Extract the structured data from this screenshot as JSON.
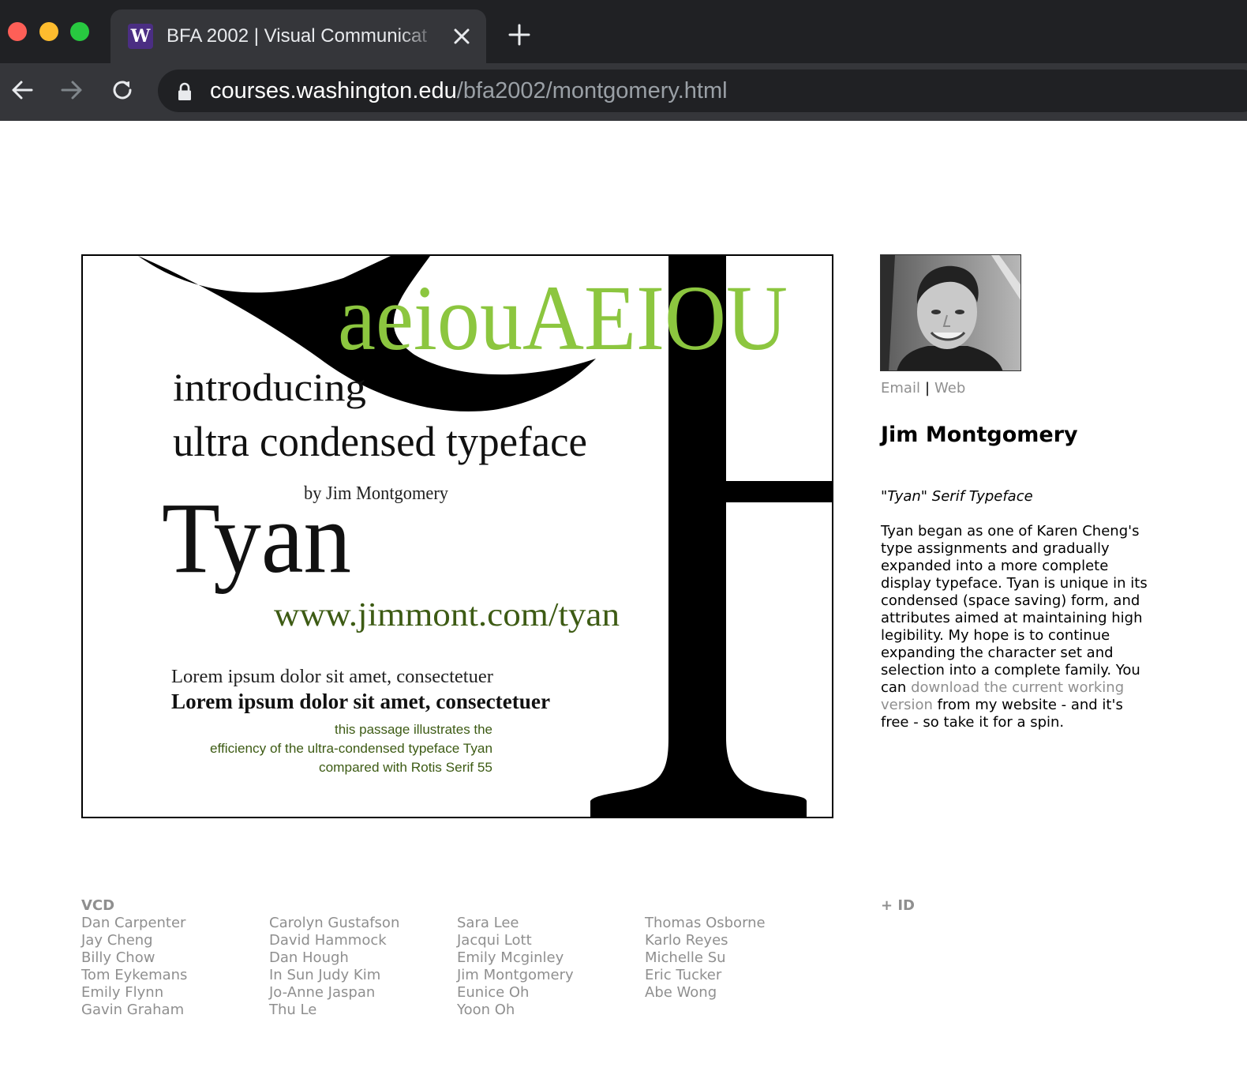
{
  "browser": {
    "tab_title": "BFA 2002 | Visual Communicat",
    "favicon_letter": "W",
    "url_host": "courses.washington.edu",
    "url_path": "/bfa2002/montgomery.html"
  },
  "poster": {
    "vowels": "aeiouAEIOU",
    "line1": "introducing",
    "line2": "ultra condensed typeface",
    "byline": "by Jim Montgomery",
    "typeface": "Tyan",
    "website": "www.jimmont.com/tyan",
    "sample_rotis": "Lorem ipsum dolor sit amet, consectetuer",
    "sample_tyan": "Lorem ipsum dolor sit amet, consectetuer",
    "caption1": "this passage illustrates the",
    "caption2": "efficiency of the ultra-condensed typeface Tyan",
    "caption3": "compared with Rotis Serif 55",
    "accent_green": "#8cc63f",
    "dark_green": "#3d5b14"
  },
  "sidebar": {
    "email_label": "Email",
    "separator": "|",
    "web_label": "Web",
    "name": "Jim Montgomery",
    "project_title": "\"Tyan\" Serif Typeface",
    "desc_lines": [
      "Tyan began as one of Karen Cheng's",
      "type assignments and gradually",
      "expanded into a more complete",
      "display typeface. Tyan is unique in its",
      "condensed (space saving) form, and",
      "attributes aimed at maintaining high",
      "legibility. My hope is to continue",
      "expanding the character set and",
      "selection into a complete family. You"
    ],
    "desc_can": "can ",
    "download_link_1": "download the current working",
    "download_link_2": "version",
    "desc_after_link": " from my website - and it's",
    "desc_last": "free - so take it for a spin."
  },
  "footer": {
    "vcd_heading": "VCD",
    "id_heading": "+ ID",
    "columns": [
      [
        "Dan Carpenter",
        "Jay Cheng",
        "Billy Chow",
        "Tom Eykemans",
        "Emily Flynn",
        "Gavin Graham"
      ],
      [
        "Carolyn Gustafson",
        "David Hammock",
        "Dan Hough",
        "In Sun Judy Kim",
        "Jo-Anne Jaspan",
        "Thu Le"
      ],
      [
        "Sara Lee",
        "Jacqui Lott",
        "Emily Mcginley",
        "Jim Montgomery",
        "Eunice Oh",
        "Yoon Oh"
      ],
      [
        "Thomas Osborne",
        "Karlo Reyes",
        "Michelle Su",
        "Eric Tucker",
        "Abe Wong"
      ]
    ]
  }
}
